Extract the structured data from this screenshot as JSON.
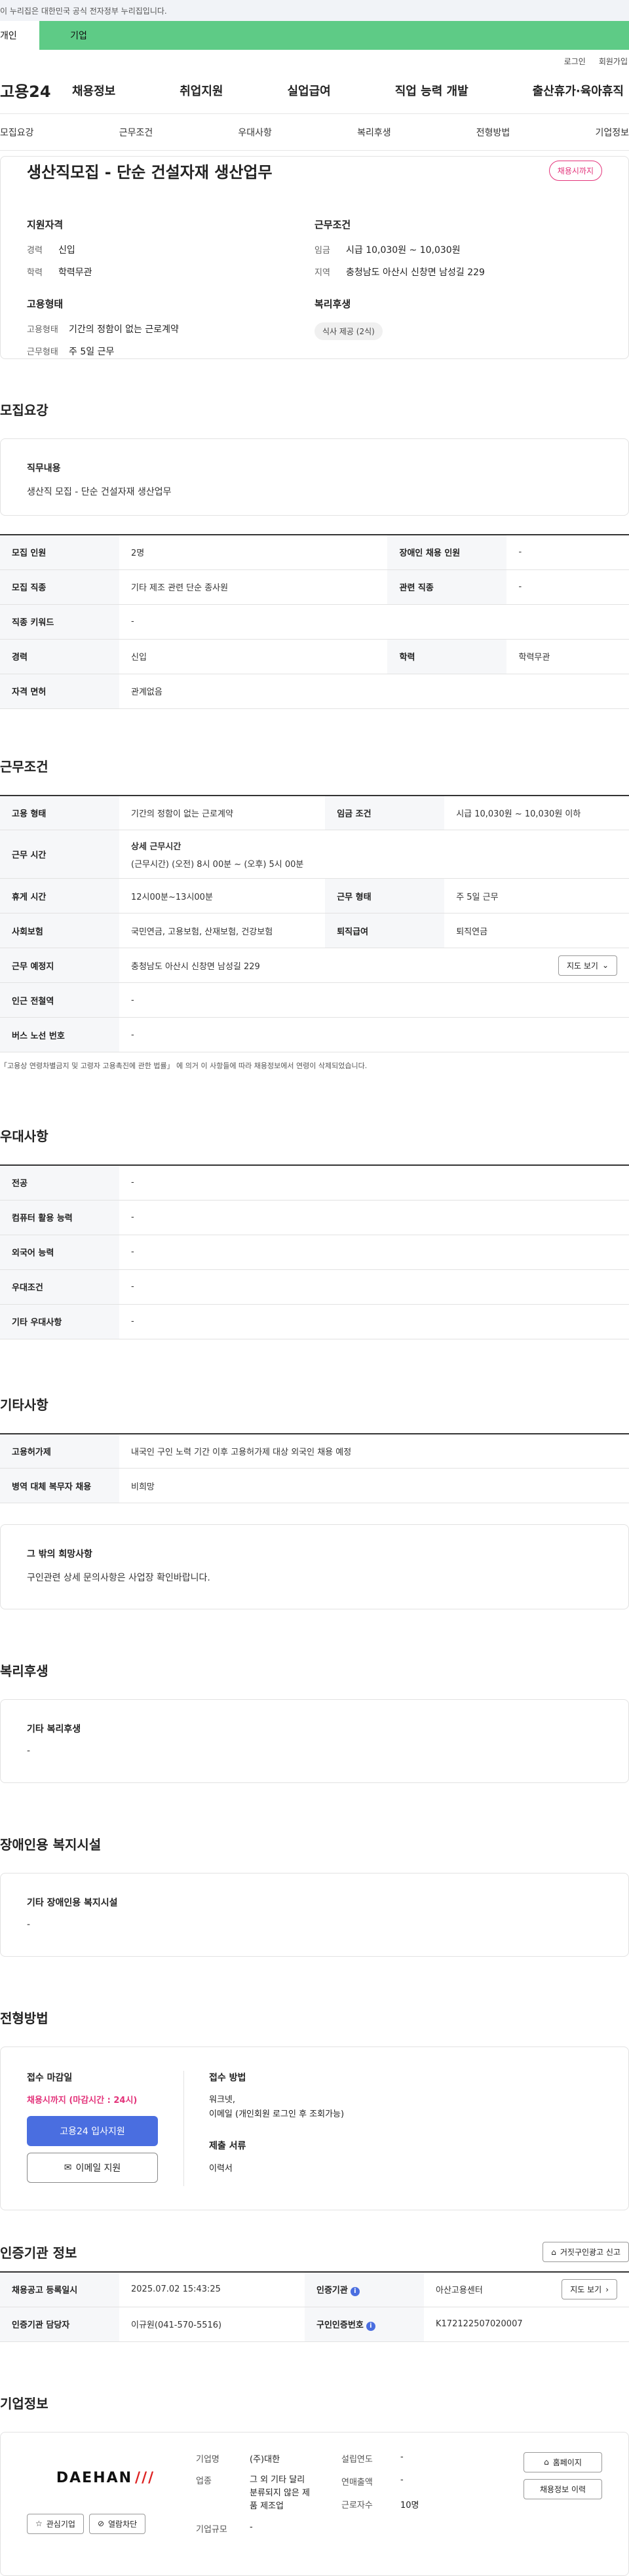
{
  "gov_banner": "이 누리집은 대한민국 공식 전자정부 누리집입니다.",
  "top_tabs": [
    "개인",
    "기업"
  ],
  "util": [
    "로그인",
    "회원가입"
  ],
  "logo": "고용24",
  "gnb": [
    "채용정보",
    "취업지원",
    "실업급여",
    "직업 능력 개발",
    "출산휴가·육아휴직"
  ],
  "anchors": [
    "모집요강",
    "근무조건",
    "우대사항",
    "복리후생",
    "전형방법",
    "기업정보"
  ],
  "summary": {
    "title": "생산직모집 - 단순 건설자재 생산업무",
    "badge": "채용시까지",
    "qual_title": "지원자격",
    "qual": [
      {
        "k": "경력",
        "v": "신입"
      },
      {
        "k": "학력",
        "v": "학력무관"
      }
    ],
    "cond_title": "근무조건",
    "cond": [
      {
        "k": "임금",
        "v": "시급 10,030원 ~ 10,030원"
      },
      {
        "k": "지역",
        "v": "충청남도 아산시 신창면 남성길 229"
      }
    ],
    "type_title": "고용형태",
    "type": [
      {
        "k": "고용형태",
        "v": "기간의 정함이 없는 근로계약"
      },
      {
        "k": "근무형태",
        "v": "주 5일 근무"
      }
    ],
    "welfare_title": "복리후생",
    "welfare_chip": "식사 제공 (2식)"
  },
  "recruit": {
    "heading": "모집요강",
    "duty_title": "직무내용",
    "duty": "생산직 모집 - 단순 건설자재 생산업무",
    "rows": [
      [
        "모집 인원",
        "2명",
        "장애인 채용 인원",
        "-"
      ],
      [
        "모집 직종",
        "기타 제조 관련 단순 종사원",
        "관련 직종",
        "-"
      ],
      [
        "직종 키워드",
        "-"
      ],
      [
        "경력",
        "신입",
        "학력",
        "학력무관"
      ],
      [
        "자격 면허",
        "관계없음"
      ]
    ]
  },
  "work": {
    "heading": "근무조건",
    "r1": [
      "고용 형태",
      "기간의 정함이 없는 근로계약",
      "임금 조건",
      "시급 10,030원 ~ 10,030원 이하"
    ],
    "r2_k": "근무 시간",
    "r2_t": "상세 근무시간",
    "r2_v": "(근무시간) (오전) 8시 00분 ~ (오후) 5시 00분",
    "r3": [
      "휴게 시간",
      "12시00분~13시00분",
      "근무 형태",
      "주 5일 근무"
    ],
    "r4": [
      "사회보험",
      "국민연금, 고용보험, 산재보험, 건강보험",
      "퇴직급여",
      "퇴직연금"
    ],
    "r5": [
      "근무 예정지",
      "충청남도 아산시 신창면 남성길 229"
    ],
    "map_btn": "지도 보기",
    "r6": [
      "인근 전철역",
      "-"
    ],
    "r7": [
      "버스 노선 번호",
      "-"
    ],
    "note": "「고용상 연령차별금지 및 고령자 고용촉진에 관한 법률」 에 의거 이 사항들에 따라 채용정보에서 연령이 삭제되었습니다."
  },
  "pref": {
    "heading": "우대사항",
    "rows": [
      [
        "전공",
        "-"
      ],
      [
        "컴퓨터 활용 능력",
        "-"
      ],
      [
        "외국어 능력",
        "-"
      ],
      [
        "우대조건",
        "-"
      ],
      [
        "기타 우대사항",
        "-"
      ]
    ]
  },
  "etc": {
    "heading": "기타사항",
    "rows": [
      [
        "고용허가제",
        "내국인 구인 노력 기간 이후 고용허가제 대상 외국인 채용 예정"
      ],
      [
        "병역 대체 복무자 채용",
        "비희망"
      ]
    ],
    "box_t": "그 밖의 희망사항",
    "box_d": "구인관련 상세 문의사항은 사업장 확인바랍니다."
  },
  "benefit": {
    "heading": "복리후생",
    "t": "기타 복리후생",
    "d": "-"
  },
  "disab": {
    "heading": "장애인용 복지시설",
    "t": "기타 장애인용 복지시설",
    "d": "-"
  },
  "process": {
    "heading": "전형방법",
    "deadline_t": "접수 마감일",
    "deadline": "채용시까지 (마감시간 : 24시)",
    "apply_btn": "고용24 입사지원",
    "email_btn": "이메일 지원",
    "method_t": "접수 방법",
    "method": [
      "워크넷,",
      "이메일 (개인회원 로그인 후 조회가능)"
    ],
    "docs_t": "제출 서류",
    "docs": "이력서"
  },
  "cert": {
    "heading": "인증기관 정보",
    "report_btn": "거짓구인광고 신고",
    "r1": [
      "채용공고 등록일시",
      "2025.07.02 15:43:25",
      "인증기관",
      "아산고용센터"
    ],
    "map_btn": "지도 보기",
    "r2": [
      "인증기관 담당자",
      "이규원(041-570-5516)",
      "구인인증번호",
      "K172122507020007"
    ]
  },
  "company": {
    "heading": "기업정보",
    "logo_text": "DAEHAN",
    "fav_btn": "관심기업",
    "block_btn": "열람차단",
    "f": [
      {
        "k": "기업명",
        "v": "(주)대한"
      },
      {
        "k": "업종",
        "v": "그 외 기타 달리 분류되지 않은 제품 제조업"
      },
      {
        "k": "기업규모",
        "v": "-"
      }
    ],
    "g": [
      {
        "k": "설립연도",
        "v": "-"
      },
      {
        "k": "연매출액",
        "v": "-"
      },
      {
        "k": "근로자수",
        "v": "10명"
      }
    ],
    "home_btn": "홈페이지",
    "jobs_btn": "채용정보 이력"
  }
}
